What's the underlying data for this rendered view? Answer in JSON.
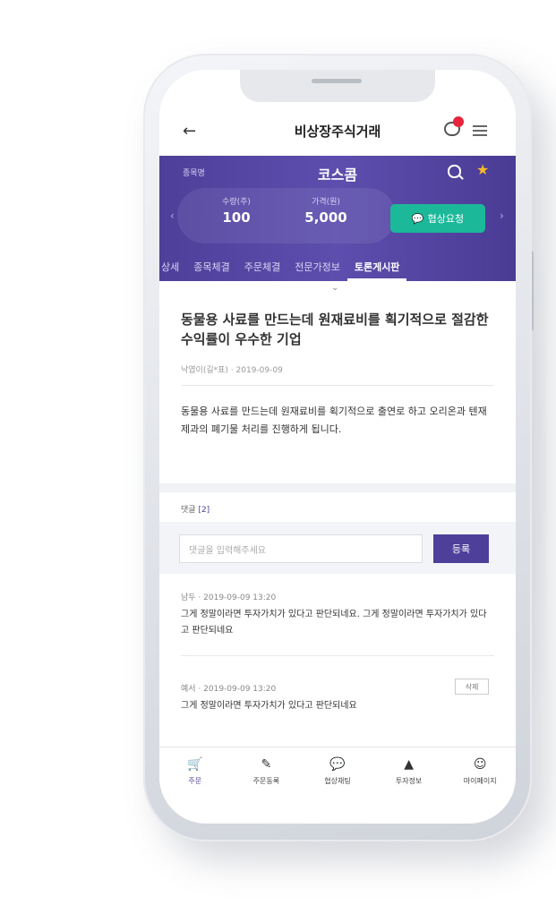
{
  "header": {
    "title": "비상장주식거래",
    "back_icon": "←",
    "chat_icon": "chat-bubble-icon",
    "menu_icon": "hamburger-menu-icon"
  },
  "stock": {
    "label": "종목명",
    "name": "코스콤",
    "quantity_label": "수량(주)",
    "quantity": "100",
    "price_label": "가격(원)",
    "price": "5,000",
    "negotiate_button": "협상요청",
    "tabs": [
      "상세",
      "종목체결",
      "주문체결",
      "전문가정보",
      "토론게시판"
    ],
    "active_tab": "토론게시판"
  },
  "post": {
    "title": "동물용 사료를 만드는데 원재료비를 획기적으로 절감한 수익률이 우수한 기업",
    "meta": "낙엽이(길*표) · 2019-09-09",
    "body": "동물용 사료를 만드는데 원재료비를 획기적으로 출연로 하고 오리온과 텐재제과의 폐기물 처리를 진행하게 됩니다."
  },
  "comments": {
    "label": "댓글",
    "count": "[2]",
    "input_placeholder": "댓글을 입력해주세요",
    "submit_label": "등록",
    "items": [
      {
        "meta": "남두 · 2019-09-09 13:20",
        "body": "그게 정말이라면 투자가치가 있다고 판단되네요. 그게 정말이라면 투자가치가 있다고 판단되네요"
      },
      {
        "meta": "예서 · 2019-09-09 13:20",
        "body": "그게 정말이라면 투자가치가 있다고 판단되네요",
        "delete_label": "삭제"
      }
    ]
  },
  "bottom_nav": [
    {
      "label": "주문",
      "icon": "cart-icon",
      "glyph": "🛒"
    },
    {
      "label": "주문동록",
      "icon": "pencil-icon",
      "glyph": "✎"
    },
    {
      "label": "협상채팅",
      "icon": "chat-icon",
      "glyph": "💬"
    },
    {
      "label": "투자정보",
      "icon": "info-icon",
      "glyph": "▲"
    },
    {
      "label": "마이페이지",
      "icon": "person-icon",
      "glyph": "☺"
    }
  ],
  "colors": {
    "primary": "#4e3f9a",
    "accent_green": "#1bb89a",
    "star": "#f7b92a",
    "badge": "#e8243c"
  }
}
